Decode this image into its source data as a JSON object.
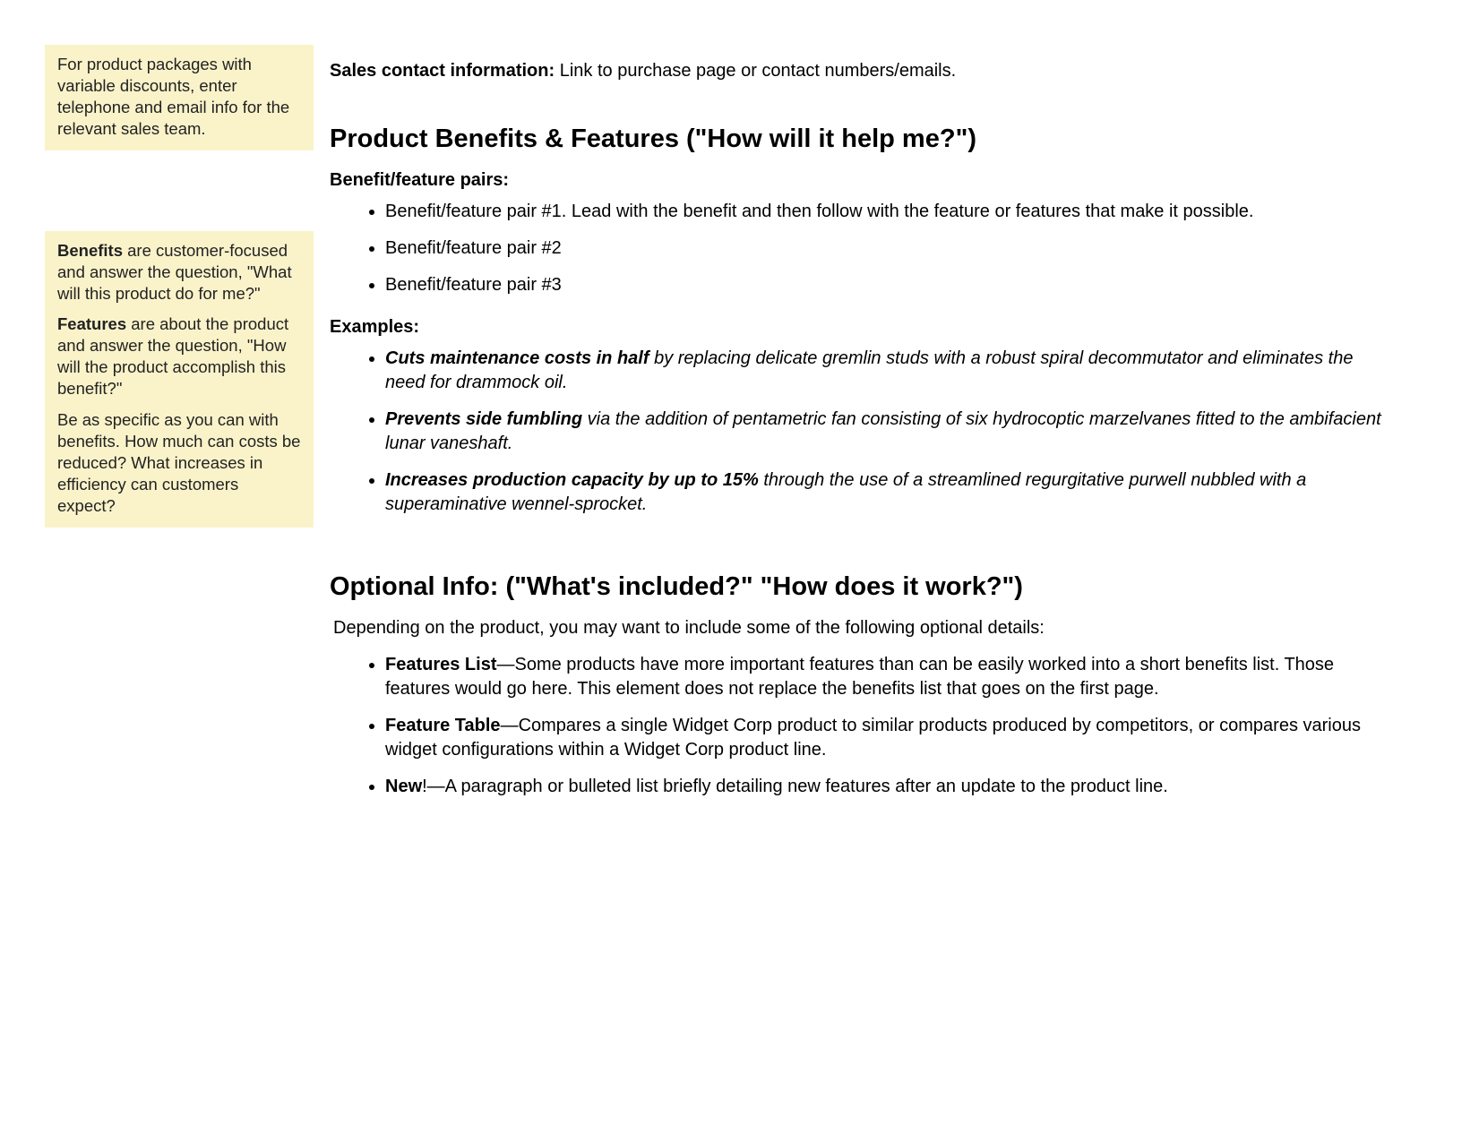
{
  "sidebar": {
    "note1": "For product packages with variable discounts, enter telephone and email info for the relevant sales team.",
    "note2": {
      "p1_bold": "Benefits",
      "p1_rest": " are customer-focused and answer the question, \"What will this product do for me?\"",
      "p2_bold": "Features",
      "p2_rest": " are about the product and answer the question, \"How will the product accomplish this benefit?\"",
      "p3": "Be as specific as you can with benefits. How much can costs be reduced? What increases in efficiency can customers expect?"
    }
  },
  "contact": {
    "label": "Sales contact information:",
    "text": " Link to purchase page or contact numbers/emails."
  },
  "benefits_section": {
    "heading": "Product Benefits & Features (\"How will it help me?\")",
    "pairs_label": "Benefit/feature pairs:",
    "pairs": [
      "Benefit/feature pair #1. Lead with the benefit and then follow with the feature or features that make it possible.",
      "Benefit/feature pair #2",
      "Benefit/feature pair #3"
    ],
    "examples_label": "Examples:",
    "examples": [
      {
        "bold": "Cuts maintenance costs in half",
        "rest": " by replacing delicate gremlin studs with a robust spiral decommutator and eliminates the need for drammock oil."
      },
      {
        "bold": "Prevents side fumbling",
        "rest": " via the addition of pentametric fan consisting of six hydrocoptic marzelvanes fitted to the ambifacient lunar vaneshaft."
      },
      {
        "bold": "Increases production capacity by up to 15%",
        "rest": " through the use of a streamlined regurgitative purwell nubbled with a superaminative wennel-sprocket."
      }
    ]
  },
  "optional_section": {
    "heading": "Optional Info: (\"What's included?\" \"How does it work?\")",
    "intro": "Depending on the product, you may want to include some of the following optional details:",
    "items": [
      {
        "lead": "Features List",
        "rest": "—Some products have more important features than can be easily worked into a short benefits list. Those features would go here. This element does not replace the benefits list that goes on the first page."
      },
      {
        "lead": "Feature Table",
        "rest": "—Compares a single Widget Corp product to similar products produced by competitors, or compares various widget configurations within a Widget Corp product line."
      },
      {
        "lead": "New",
        "rest": "!—A paragraph or bulleted list briefly detailing new features after an update to the product line."
      }
    ]
  }
}
